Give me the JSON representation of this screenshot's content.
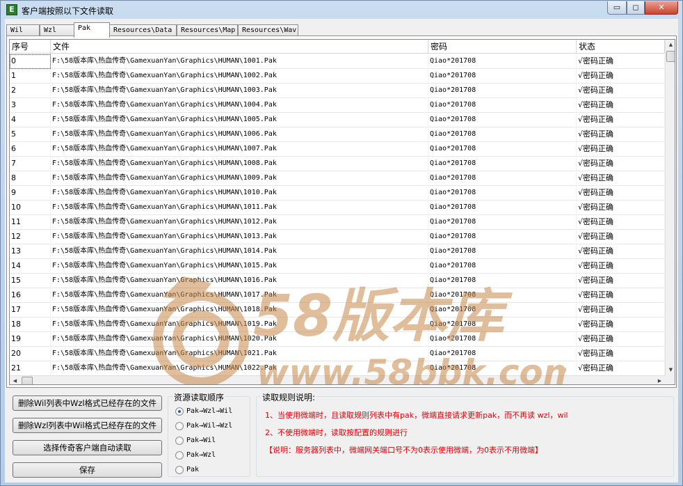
{
  "window": {
    "title": "客户端按照以下文件读取",
    "icon_letter": "E",
    "min_glyph": "▭",
    "max_glyph": "◻",
    "close_glyph": "✕"
  },
  "tabs": [
    {
      "label": "Wil"
    },
    {
      "label": "Wzl"
    },
    {
      "label": "Pak",
      "active": true
    },
    {
      "label": "Resources\\Data"
    },
    {
      "label": "Resources\\Map"
    },
    {
      "label": "Resources\\Wav"
    }
  ],
  "grid": {
    "columns": [
      "序号",
      "文件",
      "密码",
      "状态"
    ],
    "rows": [
      [
        "0",
        "F:\\58版本库\\热血传奇\\GamexuanYan\\Graphics\\HUMAN\\1001.Pak",
        "Qiao*201708",
        "√密码正确"
      ],
      [
        "1",
        "F:\\58版本库\\热血传奇\\GamexuanYan\\Graphics\\HUMAN\\1002.Pak",
        "Qiao*201708",
        "√密码正确"
      ],
      [
        "2",
        "F:\\58版本库\\热血传奇\\GamexuanYan\\Graphics\\HUMAN\\1003.Pak",
        "Qiao*201708",
        "√密码正确"
      ],
      [
        "3",
        "F:\\58版本库\\热血传奇\\GamexuanYan\\Graphics\\HUMAN\\1004.Pak",
        "Qiao*201708",
        "√密码正确"
      ],
      [
        "4",
        "F:\\58版本库\\热血传奇\\GamexuanYan\\Graphics\\HUMAN\\1005.Pak",
        "Qiao*201708",
        "√密码正确"
      ],
      [
        "5",
        "F:\\58版本库\\热血传奇\\GamexuanYan\\Graphics\\HUMAN\\1006.Pak",
        "Qiao*201708",
        "√密码正确"
      ],
      [
        "6",
        "F:\\58版本库\\热血传奇\\GamexuanYan\\Graphics\\HUMAN\\1007.Pak",
        "Qiao*201708",
        "√密码正确"
      ],
      [
        "7",
        "F:\\58版本库\\热血传奇\\GamexuanYan\\Graphics\\HUMAN\\1008.Pak",
        "Qiao*201708",
        "√密码正确"
      ],
      [
        "8",
        "F:\\58版本库\\热血传奇\\GamexuanYan\\Graphics\\HUMAN\\1009.Pak",
        "Qiao*201708",
        "√密码正确"
      ],
      [
        "9",
        "F:\\58版本库\\热血传奇\\GamexuanYan\\Graphics\\HUMAN\\1010.Pak",
        "Qiao*201708",
        "√密码正确"
      ],
      [
        "10",
        "F:\\58版本库\\热血传奇\\GamexuanYan\\Graphics\\HUMAN\\1011.Pak",
        "Qiao*201708",
        "√密码正确"
      ],
      [
        "11",
        "F:\\58版本库\\热血传奇\\GamexuanYan\\Graphics\\HUMAN\\1012.Pak",
        "Qiao*201708",
        "√密码正确"
      ],
      [
        "12",
        "F:\\58版本库\\热血传奇\\GamexuanYan\\Graphics\\HUMAN\\1013.Pak",
        "Qiao*201708",
        "√密码正确"
      ],
      [
        "13",
        "F:\\58版本库\\热血传奇\\GamexuanYan\\Graphics\\HUMAN\\1014.Pak",
        "Qiao*201708",
        "√密码正确"
      ],
      [
        "14",
        "F:\\58版本库\\热血传奇\\GamexuanYan\\Graphics\\HUMAN\\1015.Pak",
        "Qiao*201708",
        "√密码正确"
      ],
      [
        "15",
        "F:\\58版本库\\热血传奇\\GamexuanYan\\Graphics\\HUMAN\\1016.Pak",
        "Qiao*201708",
        "√密码正确"
      ],
      [
        "16",
        "F:\\58版本库\\热血传奇\\GamexuanYan\\Graphics\\HUMAN\\1017.Pak",
        "Qiao*201708",
        "√密码正确"
      ],
      [
        "17",
        "F:\\58版本库\\热血传奇\\GamexuanYan\\Graphics\\HUMAN\\1018.Pak",
        "Qiao*201708",
        "√密码正确"
      ],
      [
        "18",
        "F:\\58版本库\\热血传奇\\GamexuanYan\\Graphics\\HUMAN\\1019.Pak",
        "Qiao*201708",
        "√密码正确"
      ],
      [
        "19",
        "F:\\58版本库\\热血传奇\\GamexuanYan\\Graphics\\HUMAN\\1020.Pak",
        "Qiao*201708",
        "√密码正确"
      ],
      [
        "20",
        "F:\\58版本库\\热血传奇\\GamexuanYan\\Graphics\\HUMAN\\1021.Pak",
        "Qiao*201708",
        "√密码正确"
      ],
      [
        "21",
        "F:\\58版本库\\热血传奇\\GamexuanYan\\Graphics\\HUMAN\\1022.Pak",
        "Qiao*201708",
        "√密码正确"
      ]
    ]
  },
  "watermark": {
    "text_cn": "58版本库",
    "url": "www.58bbk.com"
  },
  "buttons": {
    "delete_wil": "删除Wil列表中Wzl格式已经存在的文件",
    "delete_wzl": "删除Wzl列表中Wil格式已经存在的文件",
    "auto_read": "选择传奇客户端自动读取",
    "save": "保存"
  },
  "order_group": {
    "title": "资源读取顺序",
    "options": [
      "Pak→Wzl→Wil",
      "Pak→Wil→Wzl",
      "Pak→Wil",
      "Pak→Wzl",
      "Pak"
    ],
    "selected_index": 0
  },
  "rules_group": {
    "title": "读取规则说明:",
    "lines": [
      "1、当使用微端时，且读取规则列表中有pak，微端直接请求更新pak，而不再读 wzl，wil",
      "2、不使用微端时，读取按配置的规则进行",
      "【说明：服务器列表中，微端网关端口号不为0表示使用微端，为0表示不用微端】"
    ]
  },
  "colors": {
    "rule_text": "#e0000a",
    "watermark": "#c8884a"
  }
}
